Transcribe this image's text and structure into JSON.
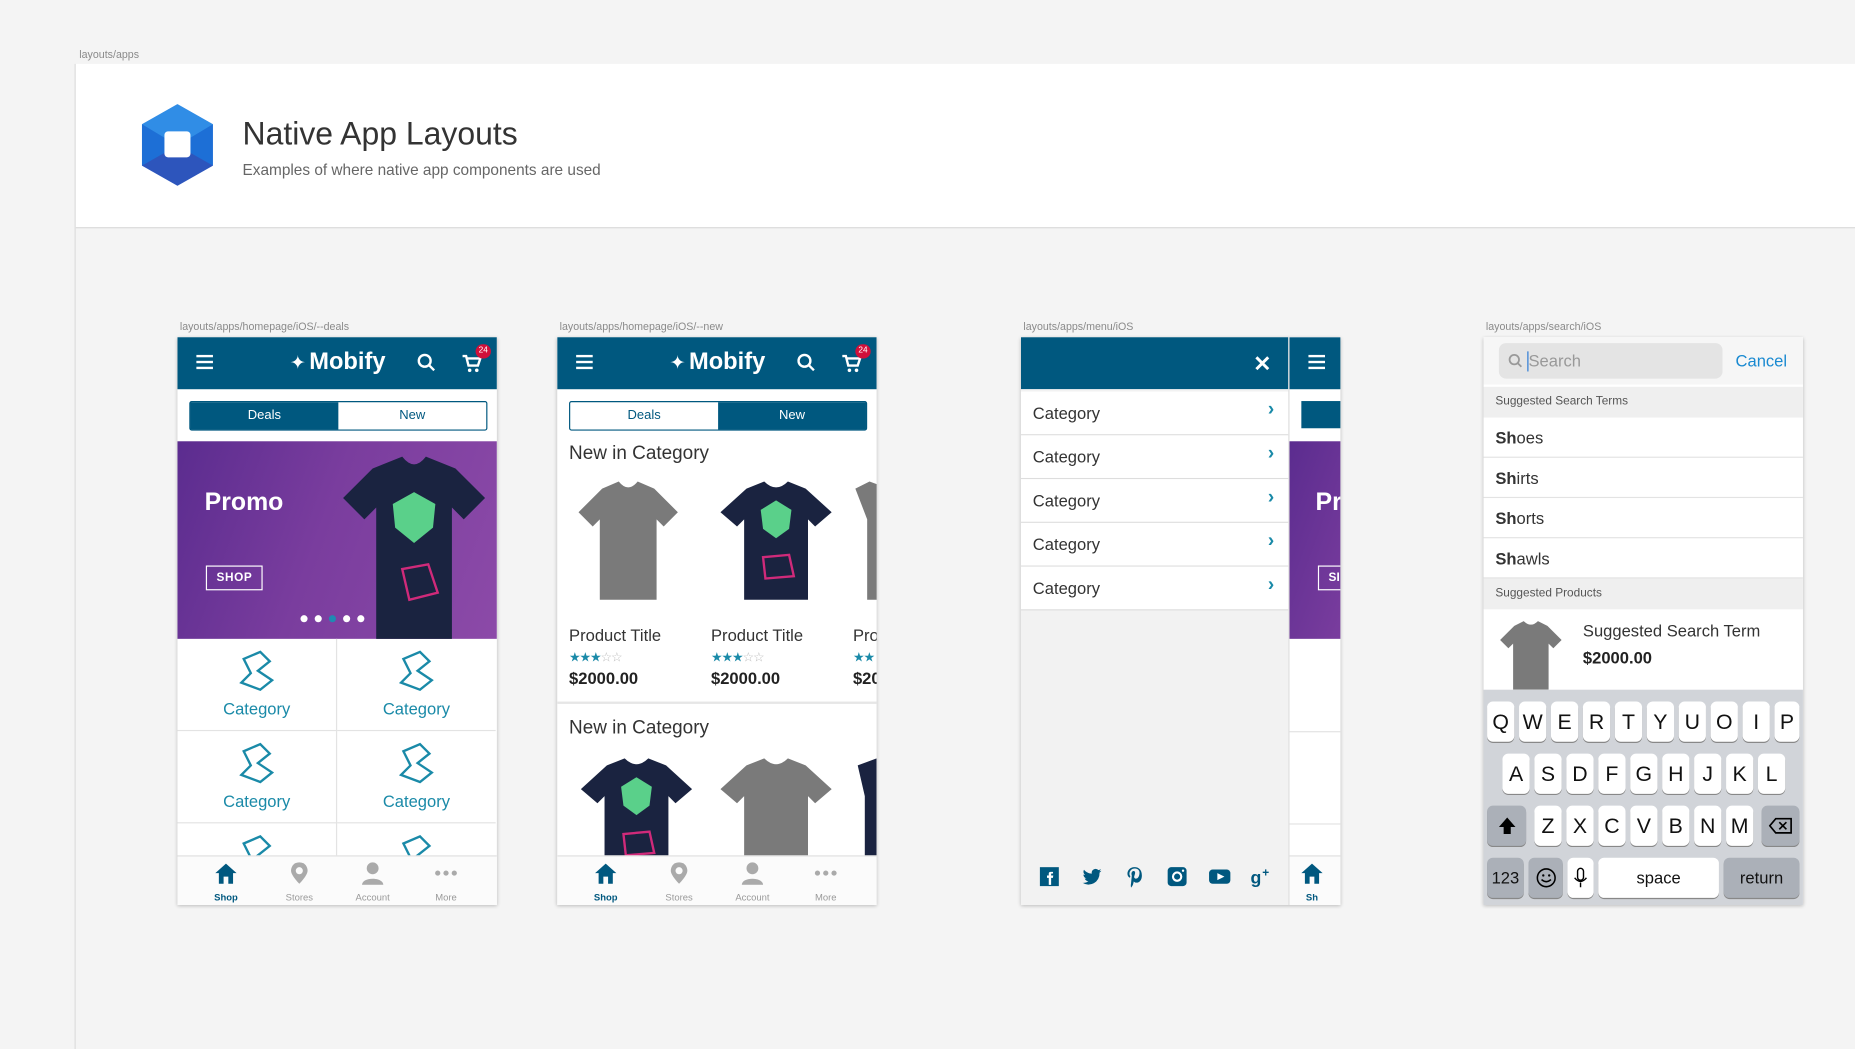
{
  "breadcrumbs": {
    "root": "layouts/apps",
    "deals": "layouts/apps/homepage/iOS/--deals",
    "new": "layouts/apps/homepage/iOS/--new",
    "menu": "layouts/apps/menu/iOS",
    "search": "layouts/apps/search/iOS"
  },
  "header": {
    "title": "Native App Layouts",
    "subtitle": "Examples of where native app components are used"
  },
  "app": {
    "brand": "Mobify",
    "cart_count": "24"
  },
  "segments": {
    "deals": "Deals",
    "new": "New"
  },
  "promo": {
    "title": "Promo",
    "button": "SHOP"
  },
  "categories": [
    "Category",
    "Category",
    "Category",
    "Category"
  ],
  "tabs": [
    {
      "label": "Shop",
      "icon": "home-icon"
    },
    {
      "label": "Stores",
      "icon": "map-pin-icon"
    },
    {
      "label": "Account",
      "icon": "person-icon"
    },
    {
      "label": "More",
      "icon": "more-dots-icon"
    }
  ],
  "new_screen": {
    "section1": "New in Category",
    "section2": "New in Category",
    "products": [
      {
        "title": "Product Title",
        "price": "$2000.00",
        "rating": 3
      },
      {
        "title": "Product Title",
        "price": "$2000.00",
        "rating": 3
      },
      {
        "title": "Pro",
        "price": "$20",
        "rating": 3
      }
    ]
  },
  "menu": {
    "items": [
      "Category",
      "Category",
      "Category",
      "Category",
      "Category"
    ],
    "peek_promo": "Pr",
    "peek_shop": "SI",
    "peek_tab": "Sh"
  },
  "search": {
    "placeholder": "Search",
    "cancel": "Cancel",
    "suggested_terms_header": "Suggested Search Terms",
    "terms": [
      {
        "bold": "Sh",
        "rest": "oes"
      },
      {
        "bold": "Sh",
        "rest": "irts"
      },
      {
        "bold": "Sh",
        "rest": "orts"
      },
      {
        "bold": "Sh",
        "rest": "awls"
      }
    ],
    "suggested_products_header": "Suggested Products",
    "product": {
      "title": "Suggested Search Term",
      "price": "$2000.00"
    }
  },
  "keyboard": {
    "row1": [
      "Q",
      "W",
      "E",
      "R",
      "T",
      "Y",
      "U",
      "O",
      "I",
      "P"
    ],
    "row2": [
      "A",
      "S",
      "D",
      "F",
      "G",
      "H",
      "J",
      "K",
      "L"
    ],
    "row3": [
      "Z",
      "X",
      "C",
      "V",
      "B",
      "N",
      "M"
    ],
    "numbers": "123",
    "space": "space",
    "return": "return"
  },
  "colors": {
    "primary": "#00587f",
    "accent": "#1a8aa8",
    "badge": "#d0103a"
  }
}
